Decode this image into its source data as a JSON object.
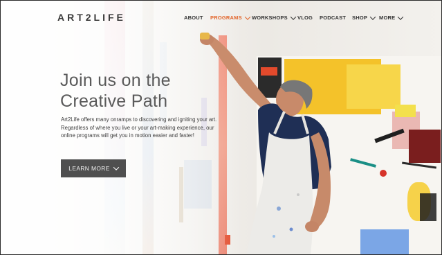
{
  "header": {
    "logo": "ART2LIFE",
    "nav": [
      {
        "label": "ABOUT",
        "dropdown": false,
        "active": false
      },
      {
        "label": "PROGRAMS",
        "dropdown": true,
        "active": true
      },
      {
        "label": "WORKSHOPS",
        "dropdown": true,
        "active": false
      },
      {
        "label": "VLOG",
        "dropdown": false,
        "active": false
      },
      {
        "label": "PODCAST",
        "dropdown": false,
        "active": false
      },
      {
        "label": "SHOP",
        "dropdown": true,
        "active": false
      },
      {
        "label": "MORE",
        "dropdown": true,
        "active": false
      }
    ]
  },
  "hero": {
    "heading_line1": "Join us on the",
    "heading_line2": "Creative Path",
    "body": "Art2Life offers many onramps to discovering and igniting your art. Regardless of where you live or your art-making experience, our online programs will get you in motion easier and faster!",
    "cta_label": "LEARN MORE",
    "cta_icon": "chevron-down-icon"
  },
  "colors": {
    "accent": "#e2652b",
    "button_bg": "#4f4f4f",
    "text_dark": "#333333"
  }
}
